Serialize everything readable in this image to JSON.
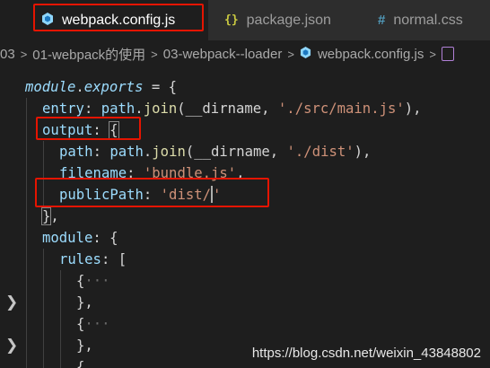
{
  "tabs": [
    {
      "label": "webpack.config.js",
      "icon": "webpack-cube-icon",
      "active": true
    },
    {
      "label": "package.json",
      "icon": "json-braces-icon",
      "active": false
    },
    {
      "label": "normal.css",
      "icon": "css-hash-icon",
      "active": false
    }
  ],
  "breadcrumb": [
    "03",
    "01-webpack的使用",
    "03-webpack--loader",
    "webpack.config.js"
  ],
  "code": {
    "l1": {
      "a": "module",
      "b": ".",
      "c": "exports",
      "d": " = {"
    },
    "l2": {
      "a": "entry",
      "b": ": ",
      "c": "path",
      "d": ".",
      "e": "join",
      "f": "(__dirname, ",
      "g": "'./src/main.js'",
      "h": "),"
    },
    "l3": {
      "a": "output",
      "b": ": ",
      "c": "{"
    },
    "l4": {
      "a": "path",
      "b": ": ",
      "c": "path",
      "d": ".",
      "e": "join",
      "f": "(__dirname, ",
      "g": "'./dist'",
      "h": "),"
    },
    "l5": {
      "a": "filename",
      "b": ": ",
      "c": "'bundle.js'",
      "d": ","
    },
    "l6": {
      "a": "publicPath",
      "b": ": ",
      "c": "'dist/",
      "d": "'"
    },
    "l7": {
      "a": "}",
      "b": ","
    },
    "l8": {
      "a": "module",
      "b": ": {"
    },
    "l9": {
      "a": "rules",
      "b": ": ["
    },
    "l10": {
      "a": "{",
      "b": "···"
    },
    "l11": {
      "a": "},"
    },
    "l12": {
      "a": "{",
      "b": "···"
    },
    "l13": {
      "a": "},"
    },
    "l14": {
      "a": "{"
    }
  },
  "watermark": "https://blog.csdn.net/weixin_43848802",
  "colors": {
    "highlight_box": "#e51400",
    "active_tab_bg": "#1e1e1e"
  }
}
